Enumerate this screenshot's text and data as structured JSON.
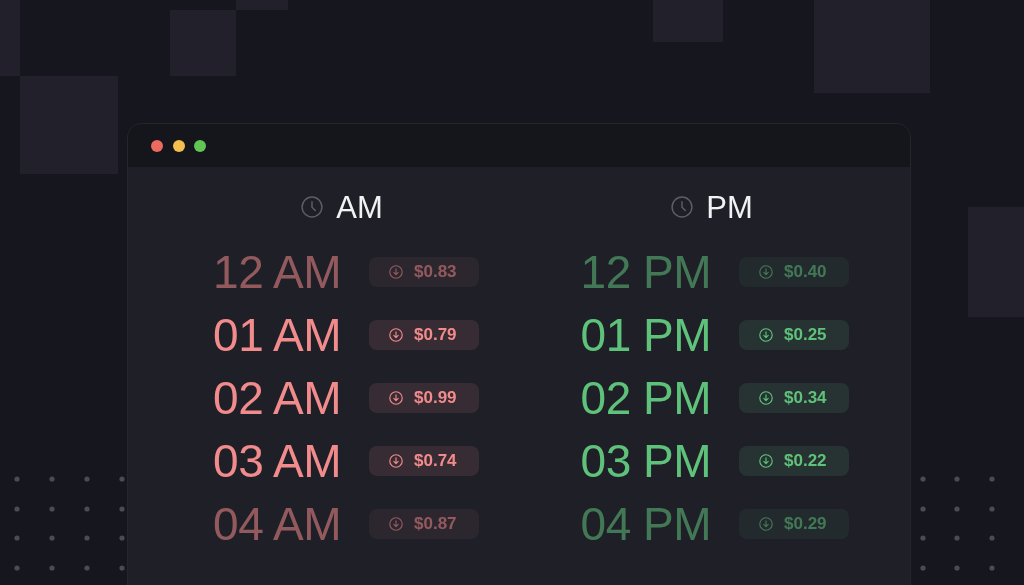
{
  "window": {
    "buttons": [
      {
        "color": "#ed6a5e"
      },
      {
        "color": "#f5bf4f"
      },
      {
        "color": "#61c554"
      }
    ]
  },
  "columns": [
    {
      "label": "AM",
      "color": "#f28b8b",
      "rows": [
        {
          "time": "12 AM",
          "price": "$0.83",
          "dimmed": true
        },
        {
          "time": "01 AM",
          "price": "$0.79",
          "dimmed": false
        },
        {
          "time": "02 AM",
          "price": "$0.99",
          "dimmed": false
        },
        {
          "time": "03 AM",
          "price": "$0.74",
          "dimmed": false
        },
        {
          "time": "04 AM",
          "price": "$0.87",
          "dimmed": true
        }
      ]
    },
    {
      "label": "PM",
      "color": "#5fc27a",
      "rows": [
        {
          "time": "12 PM",
          "price": "$0.40",
          "dimmed": true
        },
        {
          "time": "01 PM",
          "price": "$0.25",
          "dimmed": false
        },
        {
          "time": "02 PM",
          "price": "$0.34",
          "dimmed": false
        },
        {
          "time": "03 PM",
          "price": "$0.22",
          "dimmed": false
        },
        {
          "time": "04 PM",
          "price": "$0.29",
          "dimmed": true
        }
      ]
    }
  ]
}
